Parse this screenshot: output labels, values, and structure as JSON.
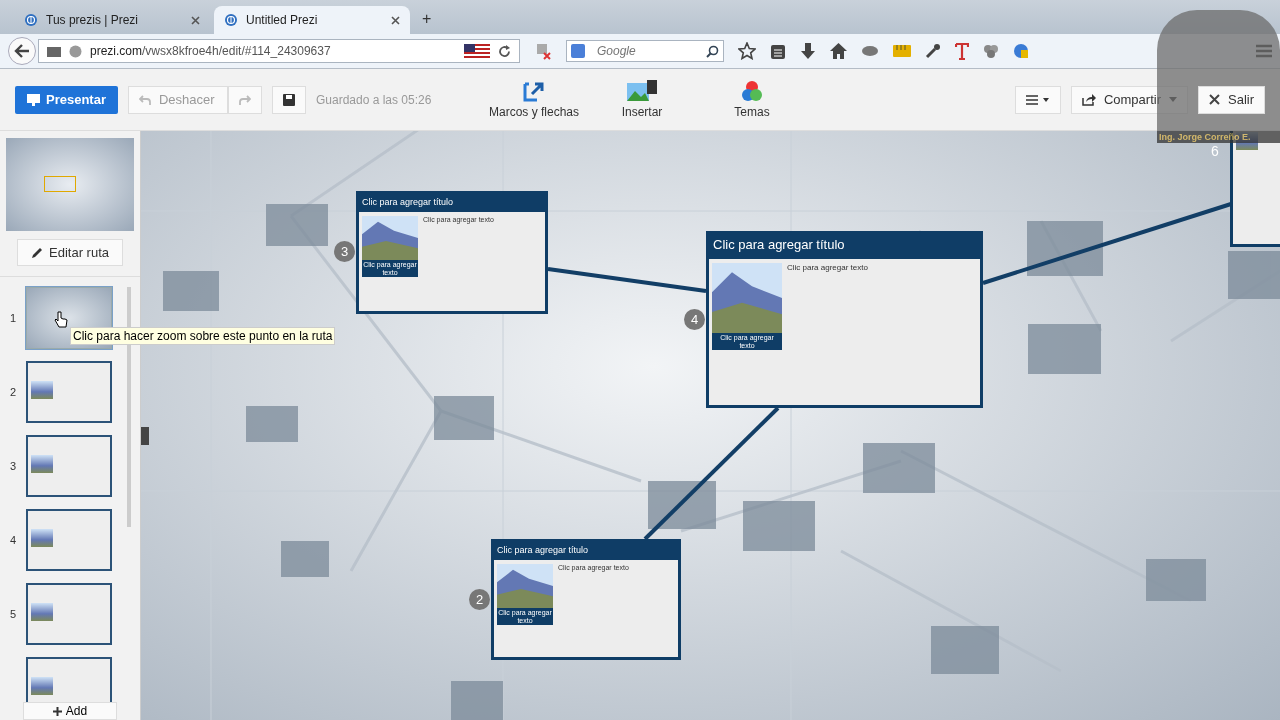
{
  "browser": {
    "tabs": [
      {
        "title": "Tus prezis | Prezi",
        "selected": false
      },
      {
        "title": "Untitled Prezi",
        "selected": true
      }
    ],
    "new_tab": "+",
    "url": {
      "domain": "prezi.com",
      "path": "/vwsx8kfroe4h/edit/#114_24309637"
    },
    "search": {
      "placeholder": "Google"
    }
  },
  "toolbar": {
    "present": "Presentar",
    "undo": {
      "label": "Deshacer",
      "disabled": true
    },
    "saved": "Guardado a las 05:26",
    "tools": [
      {
        "kind": "frames",
        "label": "Marcos y flechas"
      },
      {
        "kind": "insert",
        "label": "Insertar"
      },
      {
        "kind": "themes",
        "label": "Temas"
      }
    ],
    "share": "Compartir",
    "exit": "Salir"
  },
  "sidebar": {
    "edit_path": "Editar ruta",
    "steps": [
      {
        "number": "1",
        "kind": "overview",
        "selected": true
      },
      {
        "number": "2",
        "kind": "frame",
        "selected": false
      },
      {
        "number": "3",
        "kind": "frame",
        "selected": false
      },
      {
        "number": "4",
        "kind": "frame",
        "selected": false
      },
      {
        "number": "5",
        "kind": "frame",
        "selected": false
      },
      {
        "kind": "frame",
        "selected": false
      }
    ],
    "tooltip": "Clic para hacer zoom sobre este punto en la ruta",
    "add": "Add"
  },
  "canvas": {
    "frames": [
      {
        "number": "3",
        "title": "Clic para agregar título",
        "text": "Clic para agregar texto",
        "caption": "Clic para agregar texto"
      },
      {
        "number": "4",
        "title": "Clic para agregar título",
        "text": "Clic para agregar texto",
        "caption": "Clic para agregar texto"
      },
      {
        "number": "2",
        "title": "Clic para agregar título",
        "text": "Clic para agregar texto",
        "caption": "Clic para agregar texto"
      }
    ],
    "partial_frame": {
      "number": "6"
    }
  },
  "webcam": {
    "name": "Ing. Jorge Correño E."
  }
}
